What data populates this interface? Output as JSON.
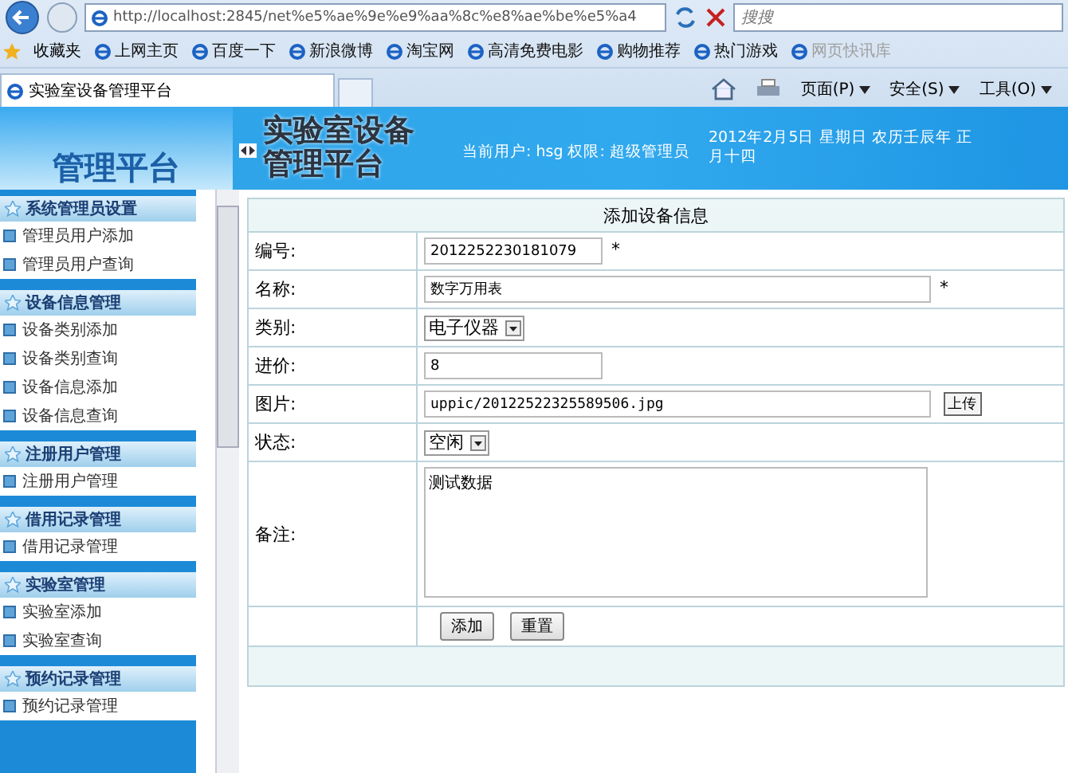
{
  "browser": {
    "address": "http://localhost:2845/net%e5%ae%9e%e9%aa%8c%e8%ae%be%e5%a4",
    "search": {
      "placeholder": "搜搜"
    },
    "favorites_label": "收藏夹",
    "favorites": [
      {
        "label": "上网主页",
        "disabled": false
      },
      {
        "label": "百度一下",
        "disabled": false
      },
      {
        "label": "新浪微博",
        "disabled": false
      },
      {
        "label": "淘宝网",
        "disabled": false
      },
      {
        "label": "高清免费电影",
        "disabled": false
      },
      {
        "label": "购物推荐",
        "disabled": false
      },
      {
        "label": "热门游戏",
        "disabled": false
      },
      {
        "label": "网页快讯库",
        "disabled": true
      }
    ],
    "tab": {
      "title": "实验室设备管理平台"
    },
    "commands": [
      "页面(P)",
      "安全(S)",
      "工具(O)"
    ]
  },
  "header": {
    "logo": "管理平台",
    "title": "实验室设备管理平台",
    "user": "当前用户: hsg 权限: 超级管理员",
    "date": "2012年2月5日  星期日  农历壬辰年 正月十四"
  },
  "sidebar": [
    {
      "title": "系统管理员设置",
      "items": [
        "管理员用户添加",
        "管理员用户查询"
      ]
    },
    {
      "title": "设备信息管理",
      "items": [
        "设备类别添加",
        "设备类别查询",
        "设备信息添加",
        "设备信息查询"
      ]
    },
    {
      "title": "注册用户管理",
      "items": [
        "注册用户管理"
      ]
    },
    {
      "title": "借用记录管理",
      "items": [
        "借用记录管理"
      ]
    },
    {
      "title": "实验室管理",
      "items": [
        "实验室添加",
        "实验室查询"
      ]
    },
    {
      "title": "预约记录管理",
      "items": [
        "预约记录管理"
      ]
    }
  ],
  "form": {
    "title": "添加设备信息",
    "fields": [
      {
        "label": "编号:",
        "kind": "short",
        "value": "2012252230181079",
        "note": "*"
      },
      {
        "label": "名称:",
        "kind": "long",
        "value": "数字万用表",
        "note": "*"
      },
      {
        "label": "类别:",
        "kind": "select",
        "value": "电子仪器"
      },
      {
        "label": "进价:",
        "kind": "short",
        "value": "8"
      },
      {
        "label": "图片:",
        "kind": "upload",
        "value": "uppic/20122522325589506.jpg",
        "button": "上传"
      },
      {
        "label": "状态:",
        "kind": "select",
        "value": "空闲"
      },
      {
        "label": "备注:",
        "kind": "textarea",
        "value": "测试数据"
      }
    ],
    "buttons": [
      "添加",
      "重置"
    ]
  }
}
